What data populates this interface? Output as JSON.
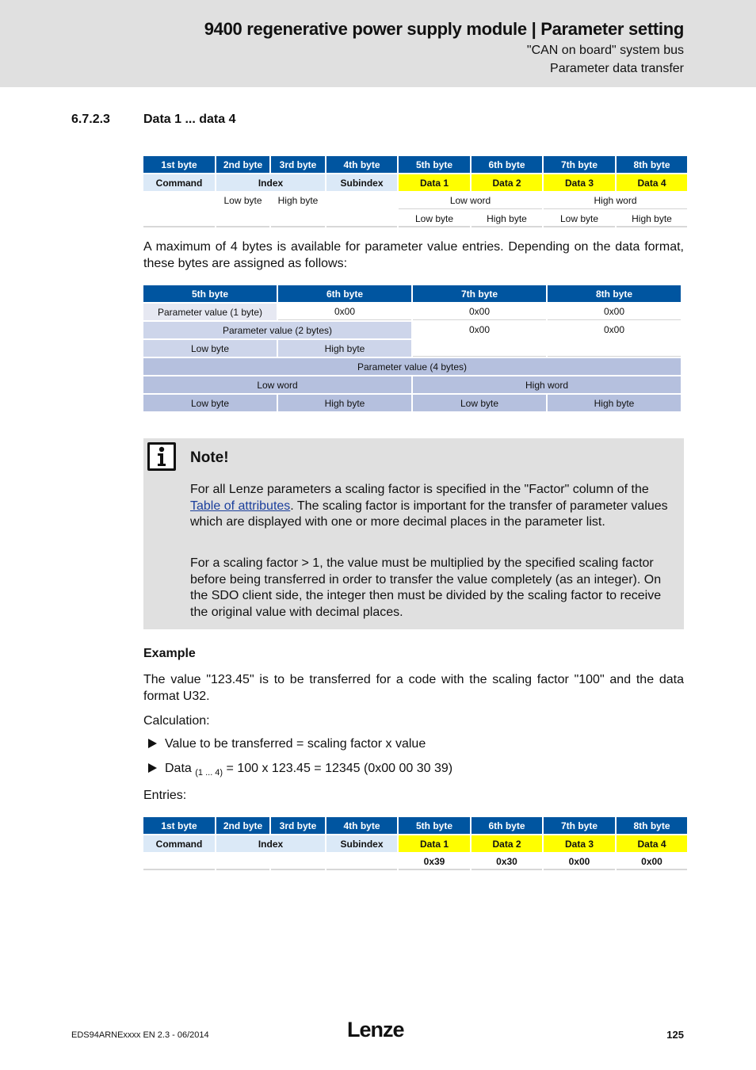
{
  "header": {
    "title": "9400 regenerative power supply module | Parameter setting",
    "subtitle1": "\"CAN on board\" system bus",
    "subtitle2": "Parameter data transfer"
  },
  "section": {
    "number": "6.7.2.3",
    "title": "Data 1 ... data 4"
  },
  "table1": {
    "headers": [
      "1st byte",
      "2nd byte",
      "3rd byte",
      "4th byte",
      "5th byte",
      "6th byte",
      "7th byte",
      "8th byte"
    ],
    "labels": {
      "command": "Command",
      "index": "Index",
      "subindex": "Subindex",
      "data": [
        "Data 1",
        "Data 2",
        "Data 3",
        "Data 4"
      ]
    },
    "row3": {
      "index_low": "Low byte",
      "index_high": "High byte",
      "low_word": "Low word",
      "high_word": "High word"
    },
    "row4": [
      "Low byte",
      "High byte",
      "Low byte",
      "High byte"
    ]
  },
  "intro_text": "A maximum of 4 bytes is available for parameter value entries. Depending on the data format, these bytes are assigned as follows:",
  "table2": {
    "headers": [
      "5th byte",
      "6th byte",
      "7th byte",
      "8th byte"
    ],
    "row1": {
      "label": "Parameter value (1 byte)",
      "values": [
        "0x00",
        "0x00",
        "0x00"
      ]
    },
    "row2": {
      "label": "Parameter value (2 bytes)",
      "values": [
        "0x00",
        "0x00"
      ]
    },
    "row3": [
      "Low byte",
      "High byte"
    ],
    "row4": {
      "label": "Parameter value (4 bytes)"
    },
    "row5": [
      "Low word",
      "High word"
    ],
    "row6": [
      "Low byte",
      "High byte",
      "Low byte",
      "High byte"
    ]
  },
  "note": {
    "title": "Note!",
    "p1_before": "For all Lenze parameters a scaling factor is specified in the \"Factor\" column of the ",
    "p1_link": "Table of attributes",
    "p1_after": ". The scaling factor is important for the transfer of parameter values which are displayed with one or more decimal places in the parameter list.",
    "p2": "For a scaling factor > 1, the value must be multiplied by the specified scaling factor before being transferred in order to transfer the value completely (as an integer). On the SDO client side, the integer then must be divided by the scaling factor to receive the original value with decimal places."
  },
  "example": {
    "title": "Example",
    "text": "The value \"123.45\" is to be transferred for a code with the scaling factor \"100\" and the data format U32.",
    "calc_label": "Calculation:",
    "bullet1": "Value to be transferred = scaling factor x value",
    "bullet2_pre": "Data ",
    "bullet2_sub": "(1 ... 4)",
    "bullet2_post": " = 100 x 123.45 = 12345 (0x00 00 30 39)",
    "entries_label": "Entries:"
  },
  "table3": {
    "headers": [
      "1st byte",
      "2nd byte",
      "3rd byte",
      "4th byte",
      "5th byte",
      "6th byte",
      "7th byte",
      "8th byte"
    ],
    "labels": {
      "command": "Command",
      "index": "Index",
      "subindex": "Subindex",
      "data": [
        "Data 1",
        "Data 2",
        "Data 3",
        "Data 4"
      ]
    },
    "values": [
      "0x39",
      "0x30",
      "0x00",
      "0x00"
    ]
  },
  "footer": {
    "doc_id": "EDS94ARNExxxx EN 2.3 - 06/2014",
    "logo": "Lenze",
    "page": "125"
  }
}
